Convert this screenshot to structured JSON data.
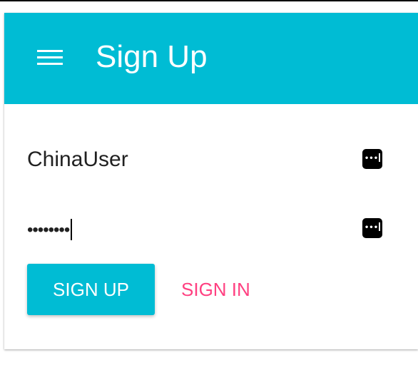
{
  "appbar": {
    "title": "Sign Up",
    "menu_icon": "hamburger-menu-icon",
    "color": "#00bcd4"
  },
  "form": {
    "username": {
      "value": "ChinaUser",
      "icon": "password-manager-icon",
      "icon_glyph": "•••"
    },
    "password": {
      "value": "••••••••",
      "icon": "password-manager-icon",
      "icon_glyph": "•••"
    }
  },
  "actions": {
    "sign_up_label": "SIGN UP",
    "sign_in_label": "SIGN IN",
    "primary_color": "#00bcd4",
    "accent_color": "#ff4081"
  }
}
